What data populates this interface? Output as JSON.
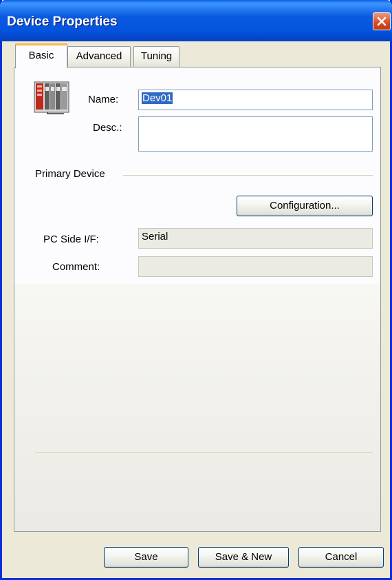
{
  "window": {
    "title": "Device Properties"
  },
  "tabs": [
    {
      "label": "Basic",
      "active": true
    },
    {
      "label": "Advanced",
      "active": false
    },
    {
      "label": "Tuning",
      "active": false
    }
  ],
  "basic": {
    "name_label": "Name:",
    "name_value": "Dev01",
    "desc_label": "Desc.:",
    "desc_value": "",
    "group_label": "Primary Device",
    "configuration_button": "Configuration...",
    "pc_side_label": "PC Side I/F:",
    "pc_side_value": "Serial",
    "comment_label": "Comment:",
    "comment_value": ""
  },
  "footer": {
    "save": "Save",
    "save_new": "Save & New",
    "cancel": "Cancel"
  },
  "colors": {
    "titlebar": "#0a5ae0",
    "close_button": "#d54a22",
    "selection": "#316ac5",
    "active_tab_accent": "#f7b64a"
  },
  "icons": {
    "device": "plc-rack-icon",
    "close": "close-icon"
  }
}
